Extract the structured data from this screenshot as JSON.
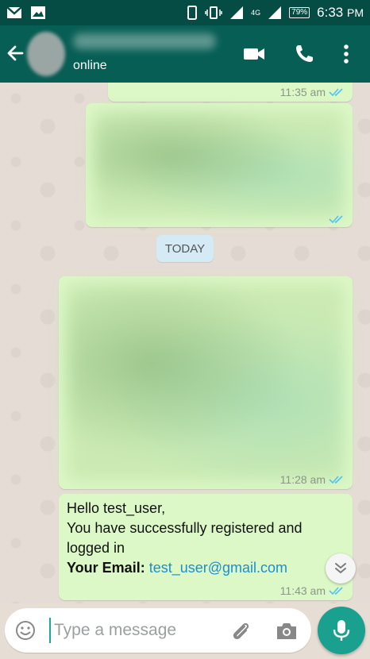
{
  "status_bar": {
    "network": "4G",
    "battery": "79%",
    "time": "6:33",
    "ampm": "PM"
  },
  "header": {
    "status": "online"
  },
  "messages": [
    {
      "time": "11:35 am",
      "ticks": "read"
    },
    {
      "time": "",
      "ticks": "read"
    },
    {
      "time": "11:28 am",
      "ticks": "read"
    },
    {
      "greeting": "Hello test_user,",
      "line1": "You have successfully registered and",
      "line2": "logged in",
      "email_label": "Your Email:",
      "email": "test_user@gmail.com",
      "time": "11:43 am",
      "ticks": "read"
    }
  ],
  "date_separator": "TODAY",
  "composer": {
    "placeholder": "Type a message"
  },
  "icons": {
    "back": "arrow-left-icon",
    "video": "video-call-icon",
    "call": "phone-icon",
    "menu": "more-vert-icon",
    "emoji": "emoji-icon",
    "attach": "paperclip-icon",
    "camera": "camera-icon",
    "mic": "mic-icon",
    "scroll_down": "double-chevron-down-icon"
  },
  "colors": {
    "header": "#075e54",
    "status_bar": "#054d44",
    "outgoing_bubble": "#dcf8c6",
    "read_ticks": "#4fc3f7",
    "accent": "#1aa08f"
  }
}
